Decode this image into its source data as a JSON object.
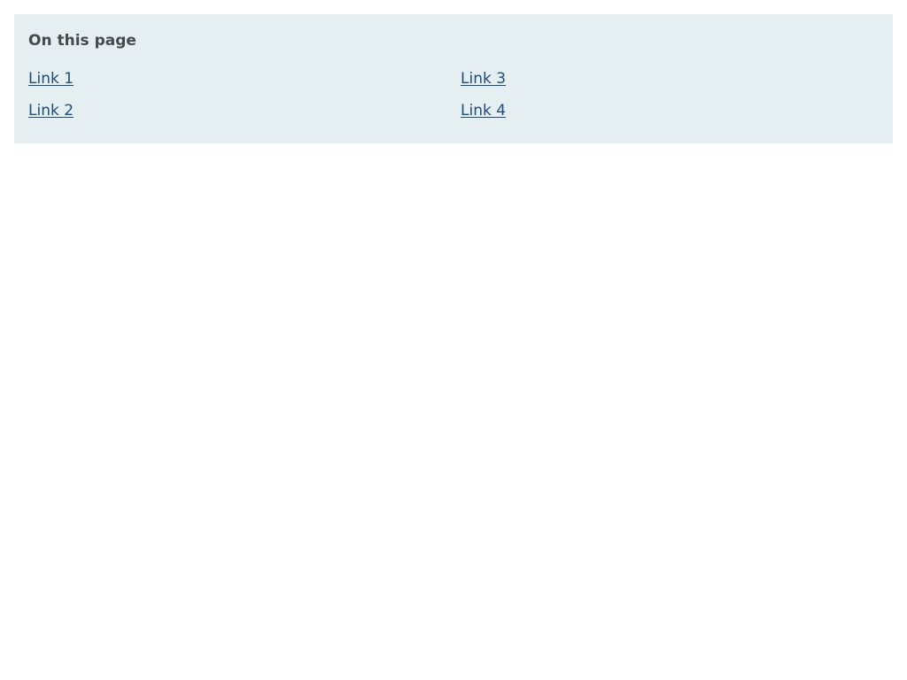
{
  "toc": {
    "title": "On this page",
    "links": [
      {
        "label": "Link 1"
      },
      {
        "label": "Link 2"
      },
      {
        "label": "Link 3"
      },
      {
        "label": "Link 4"
      }
    ]
  },
  "colors": {
    "panel_background": "#e5eef1",
    "title_text": "#444a4d",
    "link_text": "#1d4e7a"
  }
}
